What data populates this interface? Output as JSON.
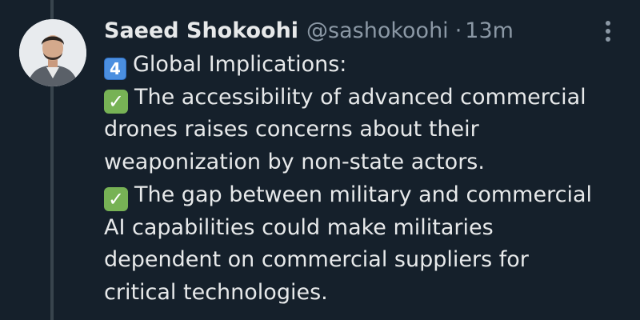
{
  "tweet": {
    "author": {
      "display_name": "Saeed Shokoohi",
      "handle": "@sashokoohi",
      "separator": "·",
      "time": "13m"
    },
    "icons": {
      "keycap": "keycap-four-icon",
      "check": "check-mark-button-icon",
      "more": "more-options-icon"
    },
    "colors": {
      "background": "#15202b",
      "text": "#e7e9ea",
      "muted": "#8b98a5",
      "check": "#77b255",
      "keycap": "#4b8fe0"
    },
    "body": {
      "keycap_digit": "4",
      "check_glyph": "✓",
      "lines": [
        "Global Implications:",
        "The accessibility of advanced commercial",
        "drones raises concerns about their",
        "weaponization by non-state actors.",
        "The gap between military and commercial",
        "AI capabilities could make militaries",
        "dependent on commercial suppliers for",
        "critical technologies."
      ]
    }
  }
}
